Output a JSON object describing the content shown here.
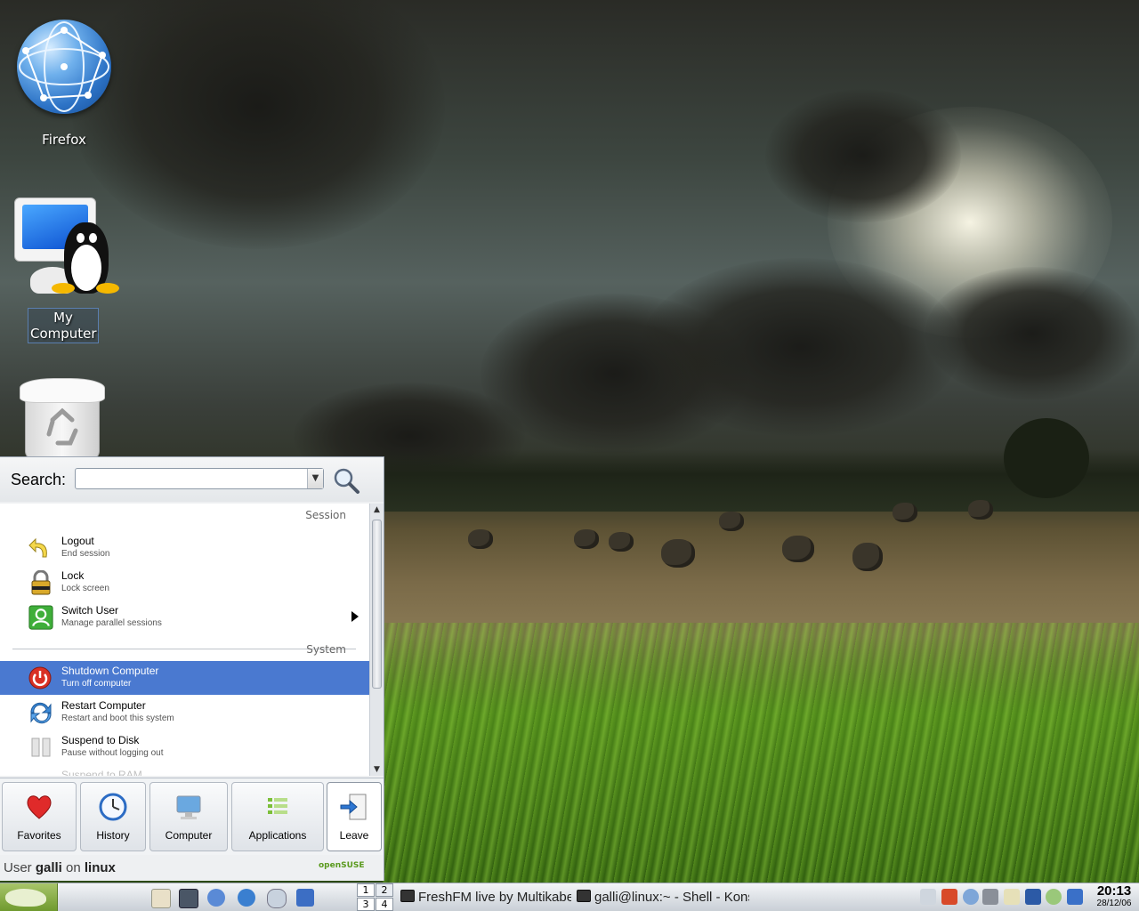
{
  "desktop": {
    "icons": [
      {
        "label": "Firefox",
        "icon": "globe-icon"
      },
      {
        "label": "My Computer",
        "icon": "computer-tux-icon"
      },
      {
        "label": "",
        "icon": "trash-icon"
      }
    ]
  },
  "kmenu": {
    "search_label": "Search:",
    "search_value": "",
    "sections": [
      {
        "title": "Session",
        "items": [
          {
            "title": "Logout",
            "subtitle": "End session",
            "icon": "logout-arrow-icon"
          },
          {
            "title": "Lock",
            "subtitle": "Lock screen",
            "icon": "padlock-icon"
          },
          {
            "title": "Switch User",
            "subtitle": "Manage parallel sessions",
            "icon": "switch-user-icon",
            "has_submenu": true
          }
        ]
      },
      {
        "title": "System",
        "items": [
          {
            "title": "Shutdown Computer",
            "subtitle": "Turn off computer",
            "icon": "power-icon",
            "selected": true
          },
          {
            "title": "Restart Computer",
            "subtitle": "Restart and boot this system",
            "icon": "restart-icon"
          },
          {
            "title": "Suspend to Disk",
            "subtitle": "Pause without logging out",
            "icon": "suspend-icon"
          },
          {
            "title": "Suspend to RAM",
            "subtitle": "",
            "icon": ""
          }
        ]
      }
    ],
    "tabs": [
      {
        "label": "Favorites",
        "icon": "heart-icon"
      },
      {
        "label": "History",
        "icon": "clock-icon"
      },
      {
        "label": "Computer",
        "icon": "monitor-icon"
      },
      {
        "label": "Applications",
        "icon": "applications-list-icon"
      },
      {
        "label": "Leave",
        "icon": "leave-door-icon",
        "active": true
      }
    ],
    "footer": {
      "prefix": "User",
      "user": "galli",
      "middle": "on",
      "host": "linux",
      "brand": "openSUSE"
    }
  },
  "taskbar": {
    "pager": [
      "1",
      "2",
      "3",
      "4"
    ],
    "active_desktop": "2",
    "tasks": [
      {
        "title": "FreshFM live by Multikabel"
      },
      {
        "title": "galli@linux:~ - Shell - Konsole"
      }
    ],
    "clock": {
      "time": "20:13",
      "date": "28/12/06"
    }
  },
  "colors": {
    "selection": "#4a79d0",
    "taskbar_top": "#f3f5f7",
    "kbutton": "#7fa83a"
  }
}
